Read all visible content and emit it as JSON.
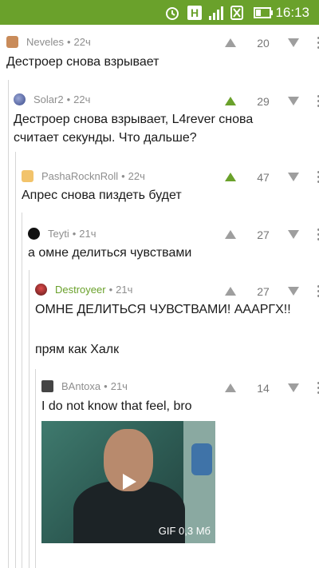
{
  "status_bar": {
    "time": "16:13"
  },
  "comments": [
    {
      "author": "Neveles",
      "age": "22ч",
      "score": "20",
      "upvoted": false,
      "author_color": "gray",
      "text": [
        "Дестроер снова взрывает"
      ]
    },
    {
      "author": "Solar2",
      "age": "22ч",
      "score": "29",
      "upvoted": true,
      "author_color": "gray",
      "text": [
        "Дестроер снова взрывает, L4rever снова",
        "считает секунды. Что дальше?"
      ]
    },
    {
      "author": "PashaRocknRoll",
      "age": "22ч",
      "score": "47",
      "upvoted": true,
      "author_color": "gray",
      "text": [
        "Апрес снова пиздеть будет"
      ]
    },
    {
      "author": "Teyti",
      "age": "21ч",
      "score": "27",
      "upvoted": false,
      "author_color": "gray",
      "text": [
        "а омне делиться чувствами"
      ]
    },
    {
      "author": "Destroyeer",
      "age": "21ч",
      "score": "27",
      "upvoted": false,
      "author_color": "green",
      "text": [
        "ОМНЕ ДЕЛИТЬСЯ ЧУВСТВАМИ! АААРГХ!!",
        "",
        "прям как Халк"
      ]
    },
    {
      "author": "BAntoxa",
      "age": "21ч",
      "score": "14",
      "upvoted": false,
      "author_color": "gray",
      "text": [
        "I do not know that feel, bro"
      ],
      "media": {
        "badge": "GIF 0,3 Мб"
      }
    }
  ],
  "colors": {
    "accent": "#6aa12b",
    "meta_gray": "#8e8e8e",
    "thread_line": "#d6d6d6"
  }
}
